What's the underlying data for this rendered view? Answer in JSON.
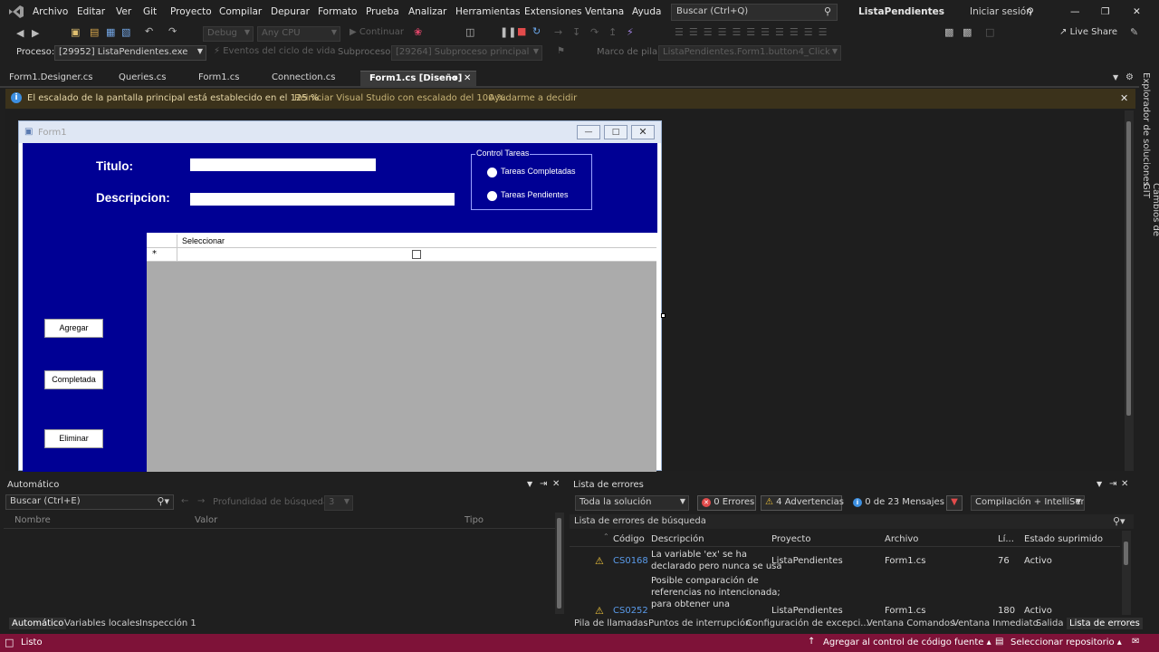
{
  "menu": {
    "items": [
      "Archivo",
      "Editar",
      "Ver",
      "Git",
      "Proyecto",
      "Compilar",
      "Depurar",
      "Formato",
      "Prueba",
      "Analizar",
      "Herramientas",
      "Extensiones",
      "Ventana",
      "Ayuda"
    ],
    "search_placeholder": "Buscar (Ctrl+Q)",
    "solution_name": "ListaPendientes",
    "signin": "Iniciar sesión"
  },
  "toolbar": {
    "config": "Debug",
    "platform": "Any CPU",
    "continue": "Continuar",
    "live_share": "Live Share"
  },
  "debugbar": {
    "process_label": "Proceso:",
    "process_value": "[29952] ListaPendientes.exe",
    "lifecycle": "Eventos del ciclo de vida",
    "thread_label": "Subproceso:",
    "thread_value": "[29264] Subproceso principal",
    "stack_label": "Marco de pila:",
    "stack_value": "ListaPendientes.Form1.button4_Click"
  },
  "tabs": [
    {
      "label": "Form1.Designer.cs"
    },
    {
      "label": "Queries.cs"
    },
    {
      "label": "Form1.cs"
    },
    {
      "label": "Connection.cs"
    },
    {
      "label": "Form1.cs [Diseño]"
    }
  ],
  "infobar": {
    "message": "El escalado de la pantalla principal está establecido en el 125 %.",
    "link1": "Reiniciar Visual Studio con escalado del 100 %",
    "link2": "Ayudarme a decidir"
  },
  "form": {
    "title": "Form1",
    "titulo_label": "Titulo:",
    "descripcion_label": "Descripcion:",
    "group_title": "Control Tareas",
    "radio1": "Tareas Completadas",
    "radio2": "Tareas Pendientes",
    "btn_agregar": "Agregar",
    "btn_completada": "Completada",
    "btn_eliminar": "Eliminar",
    "grid_col": "Seleccionar",
    "new_row_marker": "*",
    "colors": {
      "panel": "#000094",
      "grid_bg": "#ababab"
    }
  },
  "side_tabs": [
    "Explorador de soluciones",
    "Cambios de GIT"
  ],
  "auto_panel": {
    "title": "Automático",
    "search_placeholder": "Buscar (Ctrl+E)",
    "depth_label": "Profundidad de búsqueda:",
    "depth_value": "3",
    "columns": [
      "Nombre",
      "Valor",
      "Tipo"
    ],
    "bottom_tabs": [
      "Automático",
      "Variables locales",
      "Inspección 1"
    ]
  },
  "errors_panel": {
    "title": "Lista de errores",
    "scope": "Toda la solución",
    "errors": "0 Errores",
    "warnings": "4 Advertencias",
    "messages": "0 de 23 Mensajes",
    "build_filter": "Compilación + IntelliSen",
    "search_placeholder": "Lista de errores de búsqueda",
    "columns": [
      "Código",
      "Descripción",
      "Proyecto",
      "Archivo",
      "Lí...",
      "Estado suprimido"
    ],
    "rows": [
      {
        "code": "CS0168",
        "desc": [
          "La variable 'ex' se ha",
          "declarado pero nunca se usa"
        ],
        "project": "ListaPendientes",
        "file": "Form1.cs",
        "line": "76",
        "state": "Activo"
      },
      {
        "code": "CS0252",
        "desc": [
          "Posible comparación de",
          "referencias no intencionada;",
          "para obtener una"
        ],
        "project": "ListaPendientes",
        "file": "Form1.cs",
        "line": "180",
        "state": "Activo"
      }
    ],
    "bottom_tabs": [
      "Pila de llamadas",
      "Puntos de interrupción",
      "Configuración de excepci...",
      "Ventana Comandos",
      "Ventana Inmediato",
      "Salida",
      "Lista de errores"
    ]
  },
  "status": {
    "ready": "Listo",
    "source_control": "Agregar al control de código fuente",
    "repo": "Seleccionar repositorio"
  }
}
